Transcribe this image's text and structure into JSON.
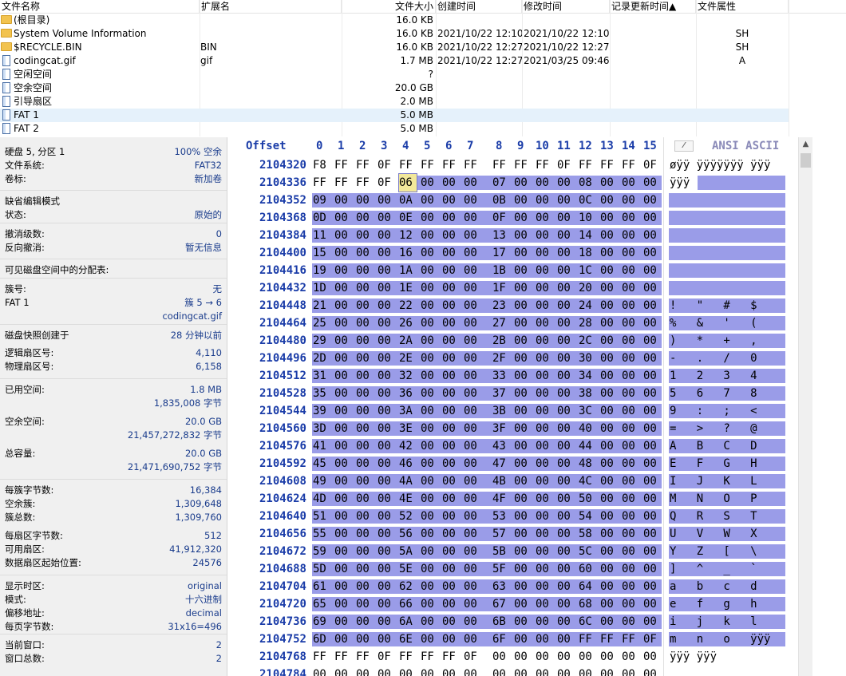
{
  "file_list": {
    "columns": [
      "文件名称",
      "扩展名",
      "文件大小",
      "创建时间",
      "修改时间",
      "记录更新时间▲",
      "文件属性"
    ],
    "rows": [
      {
        "icon": "folder-icon",
        "name": "(根目录)",
        "ext": "",
        "size": "16.0 KB",
        "created": "",
        "modified": "",
        "attr": ""
      },
      {
        "icon": "folder-icon",
        "name": "System Volume Information",
        "ext": "",
        "size": "16.0 KB",
        "created": "2021/10/22  12:10:...",
        "modified": "2021/10/22  12:10:...",
        "attr": "SH"
      },
      {
        "icon": "folder-icon",
        "name": "$RECYCLE.BIN",
        "ext": "BIN",
        "size": "16.0 KB",
        "created": "2021/10/22  12:27:...",
        "modified": "2021/10/22  12:27:...",
        "attr": "SH"
      },
      {
        "icon": "file-icon",
        "name": "codingcat.gif",
        "ext": "gif",
        "size": "1.7 MB",
        "created": "2021/10/22  12:27:...",
        "modified": "2021/03/25  09:46:...",
        "attr": "A"
      },
      {
        "icon": "file-icon",
        "name": "空闲空间",
        "ext": "",
        "size": "?",
        "created": "",
        "modified": "",
        "attr": ""
      },
      {
        "icon": "file-icon",
        "name": "空余空间",
        "ext": "",
        "size": "20.0 GB",
        "created": "",
        "modified": "",
        "attr": ""
      },
      {
        "icon": "file-icon",
        "name": "引导扇区",
        "ext": "",
        "size": "2.0 MB",
        "created": "",
        "modified": "",
        "attr": ""
      },
      {
        "icon": "file-icon",
        "name": "FAT 1",
        "ext": "",
        "size": "5.0 MB",
        "created": "",
        "modified": "",
        "attr": "",
        "selected": true
      },
      {
        "icon": "file-icon",
        "name": "FAT 2",
        "ext": "",
        "size": "5.0 MB",
        "created": "",
        "modified": "",
        "attr": ""
      }
    ]
  },
  "info_panel": {
    "rows": [
      {
        "label": "硬盘 5, 分区 1",
        "value": "100% 空余"
      },
      {
        "label": "文件系统:",
        "value": "FAT32"
      },
      {
        "label": "卷标:",
        "value": "新加卷"
      },
      {
        "label": "缺省编辑模式",
        "value": ""
      },
      {
        "label": "状态:",
        "value": "原始的"
      },
      {
        "label": "撤消级数:",
        "value": "0"
      },
      {
        "label": "反向撤消:",
        "value": "暂无信息"
      },
      {
        "label": "可见磁盘空间中的分配表:",
        "value": ""
      },
      {
        "label": "簇号:",
        "value": "无"
      },
      {
        "label": "FAT 1",
        "value": "簇 5 → 6"
      },
      {
        "label": "",
        "value": "codingcat.gif"
      },
      {
        "label": "磁盘快照创建于",
        "value": "28 分钟以前"
      },
      {
        "label": "逻辑扇区号:",
        "value": "4,110"
      },
      {
        "label": "物理扇区号:",
        "value": "6,158"
      },
      {
        "label": "已用空间:",
        "value": "1.8 MB"
      },
      {
        "label": "",
        "value": "1,835,008 字节"
      },
      {
        "label": "空余空间:",
        "value": "20.0 GB"
      },
      {
        "label": "",
        "value": "21,457,272,832 字节"
      },
      {
        "label": "总容量:",
        "value": "20.0 GB"
      },
      {
        "label": "",
        "value": "21,471,690,752 字节"
      },
      {
        "label": "每簇字节数:",
        "value": "16,384"
      },
      {
        "label": "空余簇:",
        "value": "1,309,648"
      },
      {
        "label": "簇总数:",
        "value": "1,309,760"
      },
      {
        "label": "每扇区字节数:",
        "value": "512"
      },
      {
        "label": "可用扇区:",
        "value": "41,912,320"
      },
      {
        "label": "数据扇区起始位置:",
        "value": "24576"
      },
      {
        "label": "显示时区:",
        "value": "original"
      },
      {
        "label": "模式:",
        "value": "十六进制"
      },
      {
        "label": "偏移地址:",
        "value": "decimal"
      },
      {
        "label": "每页字节数:",
        "value": "31x16=496"
      },
      {
        "label": "当前窗口:",
        "value": "2"
      },
      {
        "label": "窗口总数:",
        "value": "2"
      }
    ]
  },
  "hex_editor": {
    "offset_header": "Offset",
    "column_headers": [
      "0",
      "1",
      "2",
      "3",
      "4",
      "5",
      "6",
      "7",
      "8",
      "9",
      "10",
      "11",
      "12",
      "13",
      "14",
      "15"
    ],
    "ascii_menu_glyph": "⁄",
    "ascii_header": "ANSI ASCII",
    "rows": [
      {
        "offset": "2104320",
        "bytes": [
          "F8",
          "FF",
          "FF",
          "0F",
          "FF",
          "FF",
          "FF",
          "FF",
          "FF",
          "FF",
          "FF",
          "0F",
          "FF",
          "FF",
          "FF",
          "0F"
        ],
        "ascii": "øÿÿ ÿÿÿÿÿÿÿ ÿÿÿ",
        "hl": "none"
      },
      {
        "offset": "2104336",
        "bytes": [
          "FF",
          "FF",
          "FF",
          "0F",
          "06",
          "00",
          "00",
          "00",
          "07",
          "00",
          "00",
          "00",
          "08",
          "00",
          "00",
          "00"
        ],
        "ascii": "ÿÿÿ",
        "hl": "partial"
      },
      {
        "offset": "2104352",
        "bytes": [
          "09",
          "00",
          "00",
          "00",
          "0A",
          "00",
          "00",
          "00",
          "0B",
          "00",
          "00",
          "00",
          "0C",
          "00",
          "00",
          "00"
        ],
        "ascii": "",
        "hl": "full"
      },
      {
        "offset": "2104368",
        "bytes": [
          "0D",
          "00",
          "00",
          "00",
          "0E",
          "00",
          "00",
          "00",
          "0F",
          "00",
          "00",
          "00",
          "10",
          "00",
          "00",
          "00"
        ],
        "ascii": "",
        "hl": "full"
      },
      {
        "offset": "2104384",
        "bytes": [
          "11",
          "00",
          "00",
          "00",
          "12",
          "00",
          "00",
          "00",
          "13",
          "00",
          "00",
          "00",
          "14",
          "00",
          "00",
          "00"
        ],
        "ascii": "",
        "hl": "full"
      },
      {
        "offset": "2104400",
        "bytes": [
          "15",
          "00",
          "00",
          "00",
          "16",
          "00",
          "00",
          "00",
          "17",
          "00",
          "00",
          "00",
          "18",
          "00",
          "00",
          "00"
        ],
        "ascii": "",
        "hl": "full"
      },
      {
        "offset": "2104416",
        "bytes": [
          "19",
          "00",
          "00",
          "00",
          "1A",
          "00",
          "00",
          "00",
          "1B",
          "00",
          "00",
          "00",
          "1C",
          "00",
          "00",
          "00"
        ],
        "ascii": "",
        "hl": "full"
      },
      {
        "offset": "2104432",
        "bytes": [
          "1D",
          "00",
          "00",
          "00",
          "1E",
          "00",
          "00",
          "00",
          "1F",
          "00",
          "00",
          "00",
          "20",
          "00",
          "00",
          "00"
        ],
        "ascii": "",
        "hl": "full"
      },
      {
        "offset": "2104448",
        "bytes": [
          "21",
          "00",
          "00",
          "00",
          "22",
          "00",
          "00",
          "00",
          "23",
          "00",
          "00",
          "00",
          "24",
          "00",
          "00",
          "00"
        ],
        "ascii": "!   \"   #   $",
        "hl": "full"
      },
      {
        "offset": "2104464",
        "bytes": [
          "25",
          "00",
          "00",
          "00",
          "26",
          "00",
          "00",
          "00",
          "27",
          "00",
          "00",
          "00",
          "28",
          "00",
          "00",
          "00"
        ],
        "ascii": "%   &   '   (",
        "hl": "full"
      },
      {
        "offset": "2104480",
        "bytes": [
          "29",
          "00",
          "00",
          "00",
          "2A",
          "00",
          "00",
          "00",
          "2B",
          "00",
          "00",
          "00",
          "2C",
          "00",
          "00",
          "00"
        ],
        "ascii": ")   *   +   ,",
        "hl": "full"
      },
      {
        "offset": "2104496",
        "bytes": [
          "2D",
          "00",
          "00",
          "00",
          "2E",
          "00",
          "00",
          "00",
          "2F",
          "00",
          "00",
          "00",
          "30",
          "00",
          "00",
          "00"
        ],
        "ascii": "-   .   /   0",
        "hl": "full"
      },
      {
        "offset": "2104512",
        "bytes": [
          "31",
          "00",
          "00",
          "00",
          "32",
          "00",
          "00",
          "00",
          "33",
          "00",
          "00",
          "00",
          "34",
          "00",
          "00",
          "00"
        ],
        "ascii": "1   2   3   4",
        "hl": "full"
      },
      {
        "offset": "2104528",
        "bytes": [
          "35",
          "00",
          "00",
          "00",
          "36",
          "00",
          "00",
          "00",
          "37",
          "00",
          "00",
          "00",
          "38",
          "00",
          "00",
          "00"
        ],
        "ascii": "5   6   7   8",
        "hl": "full"
      },
      {
        "offset": "2104544",
        "bytes": [
          "39",
          "00",
          "00",
          "00",
          "3A",
          "00",
          "00",
          "00",
          "3B",
          "00",
          "00",
          "00",
          "3C",
          "00",
          "00",
          "00"
        ],
        "ascii": "9   :   ;   <",
        "hl": "full"
      },
      {
        "offset": "2104560",
        "bytes": [
          "3D",
          "00",
          "00",
          "00",
          "3E",
          "00",
          "00",
          "00",
          "3F",
          "00",
          "00",
          "00",
          "40",
          "00",
          "00",
          "00"
        ],
        "ascii": "=   >   ?   @",
        "hl": "full"
      },
      {
        "offset": "2104576",
        "bytes": [
          "41",
          "00",
          "00",
          "00",
          "42",
          "00",
          "00",
          "00",
          "43",
          "00",
          "00",
          "00",
          "44",
          "00",
          "00",
          "00"
        ],
        "ascii": "A   B   C   D",
        "hl": "full"
      },
      {
        "offset": "2104592",
        "bytes": [
          "45",
          "00",
          "00",
          "00",
          "46",
          "00",
          "00",
          "00",
          "47",
          "00",
          "00",
          "00",
          "48",
          "00",
          "00",
          "00"
        ],
        "ascii": "E   F   G   H",
        "hl": "full"
      },
      {
        "offset": "2104608",
        "bytes": [
          "49",
          "00",
          "00",
          "00",
          "4A",
          "00",
          "00",
          "00",
          "4B",
          "00",
          "00",
          "00",
          "4C",
          "00",
          "00",
          "00"
        ],
        "ascii": "I   J   K   L",
        "hl": "full"
      },
      {
        "offset": "2104624",
        "bytes": [
          "4D",
          "00",
          "00",
          "00",
          "4E",
          "00",
          "00",
          "00",
          "4F",
          "00",
          "00",
          "00",
          "50",
          "00",
          "00",
          "00"
        ],
        "ascii": "M   N   O   P",
        "hl": "full"
      },
      {
        "offset": "2104640",
        "bytes": [
          "51",
          "00",
          "00",
          "00",
          "52",
          "00",
          "00",
          "00",
          "53",
          "00",
          "00",
          "00",
          "54",
          "00",
          "00",
          "00"
        ],
        "ascii": "Q   R   S   T",
        "hl": "full"
      },
      {
        "offset": "2104656",
        "bytes": [
          "55",
          "00",
          "00",
          "00",
          "56",
          "00",
          "00",
          "00",
          "57",
          "00",
          "00",
          "00",
          "58",
          "00",
          "00",
          "00"
        ],
        "ascii": "U   V   W   X",
        "hl": "full"
      },
      {
        "offset": "2104672",
        "bytes": [
          "59",
          "00",
          "00",
          "00",
          "5A",
          "00",
          "00",
          "00",
          "5B",
          "00",
          "00",
          "00",
          "5C",
          "00",
          "00",
          "00"
        ],
        "ascii": "Y   Z   [   \\",
        "hl": "full"
      },
      {
        "offset": "2104688",
        "bytes": [
          "5D",
          "00",
          "00",
          "00",
          "5E",
          "00",
          "00",
          "00",
          "5F",
          "00",
          "00",
          "00",
          "60",
          "00",
          "00",
          "00"
        ],
        "ascii": "]   ^   _   `",
        "hl": "full"
      },
      {
        "offset": "2104704",
        "bytes": [
          "61",
          "00",
          "00",
          "00",
          "62",
          "00",
          "00",
          "00",
          "63",
          "00",
          "00",
          "00",
          "64",
          "00",
          "00",
          "00"
        ],
        "ascii": "a   b   c   d",
        "hl": "full"
      },
      {
        "offset": "2104720",
        "bytes": [
          "65",
          "00",
          "00",
          "00",
          "66",
          "00",
          "00",
          "00",
          "67",
          "00",
          "00",
          "00",
          "68",
          "00",
          "00",
          "00"
        ],
        "ascii": "e   f   g   h",
        "hl": "full"
      },
      {
        "offset": "2104736",
        "bytes": [
          "69",
          "00",
          "00",
          "00",
          "6A",
          "00",
          "00",
          "00",
          "6B",
          "00",
          "00",
          "00",
          "6C",
          "00",
          "00",
          "00"
        ],
        "ascii": "i   j   k   l",
        "hl": "full"
      },
      {
        "offset": "2104752",
        "bytes": [
          "6D",
          "00",
          "00",
          "00",
          "6E",
          "00",
          "00",
          "00",
          "6F",
          "00",
          "00",
          "00",
          "FF",
          "FF",
          "FF",
          "0F"
        ],
        "ascii": "m   n   o   ÿÿÿ",
        "hl": "full"
      },
      {
        "offset": "2104768",
        "bytes": [
          "FF",
          "FF",
          "FF",
          "0F",
          "FF",
          "FF",
          "FF",
          "0F",
          "00",
          "00",
          "00",
          "00",
          "00",
          "00",
          "00",
          "00"
        ],
        "ascii": "ÿÿÿ ÿÿÿ",
        "hl": "none"
      },
      {
        "offset": "2104784",
        "bytes": [
          "00",
          "00",
          "00",
          "00",
          "00",
          "00",
          "00",
          "00",
          "00",
          "00",
          "00",
          "00",
          "00",
          "00",
          "00",
          "00"
        ],
        "ascii": "",
        "hl": "none"
      }
    ],
    "cursor": {
      "row": 1,
      "col": 4
    },
    "highlight_color": "#9a9ce8",
    "offset_color": "#1a3ca8"
  }
}
